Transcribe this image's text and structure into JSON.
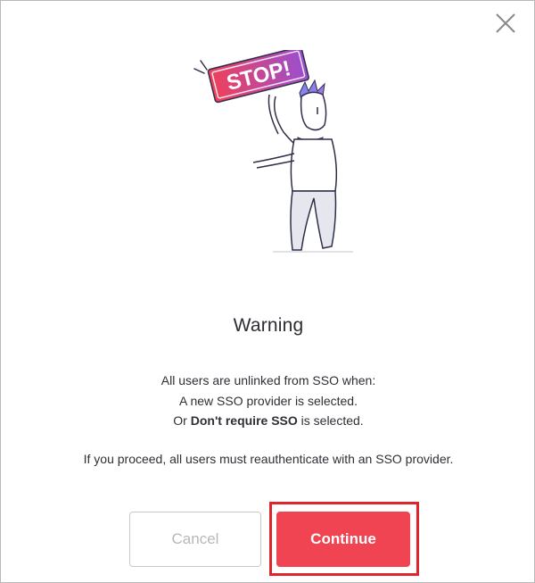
{
  "dialog": {
    "title": "Warning",
    "body_lines": {
      "line1": "All users are unlinked from SSO when:",
      "line2": "A new SSO provider is selected.",
      "line3_prefix": "Or ",
      "line3_bold": "Don't require SSO",
      "line3_suffix": " is selected."
    },
    "proceed_text": "If you proceed, all users must reauthenticate with an SSO provider.",
    "illustration": {
      "sign_text": "STOP!"
    },
    "buttons": {
      "cancel_label": "Cancel",
      "continue_label": "Continue"
    },
    "colors": {
      "continue_bg": "#f04452",
      "highlight_outline": "#e0242c",
      "sign_gradient_start": "#f0405a",
      "sign_gradient_end": "#9a4fd0"
    },
    "icons": {
      "close": "close-icon"
    }
  }
}
